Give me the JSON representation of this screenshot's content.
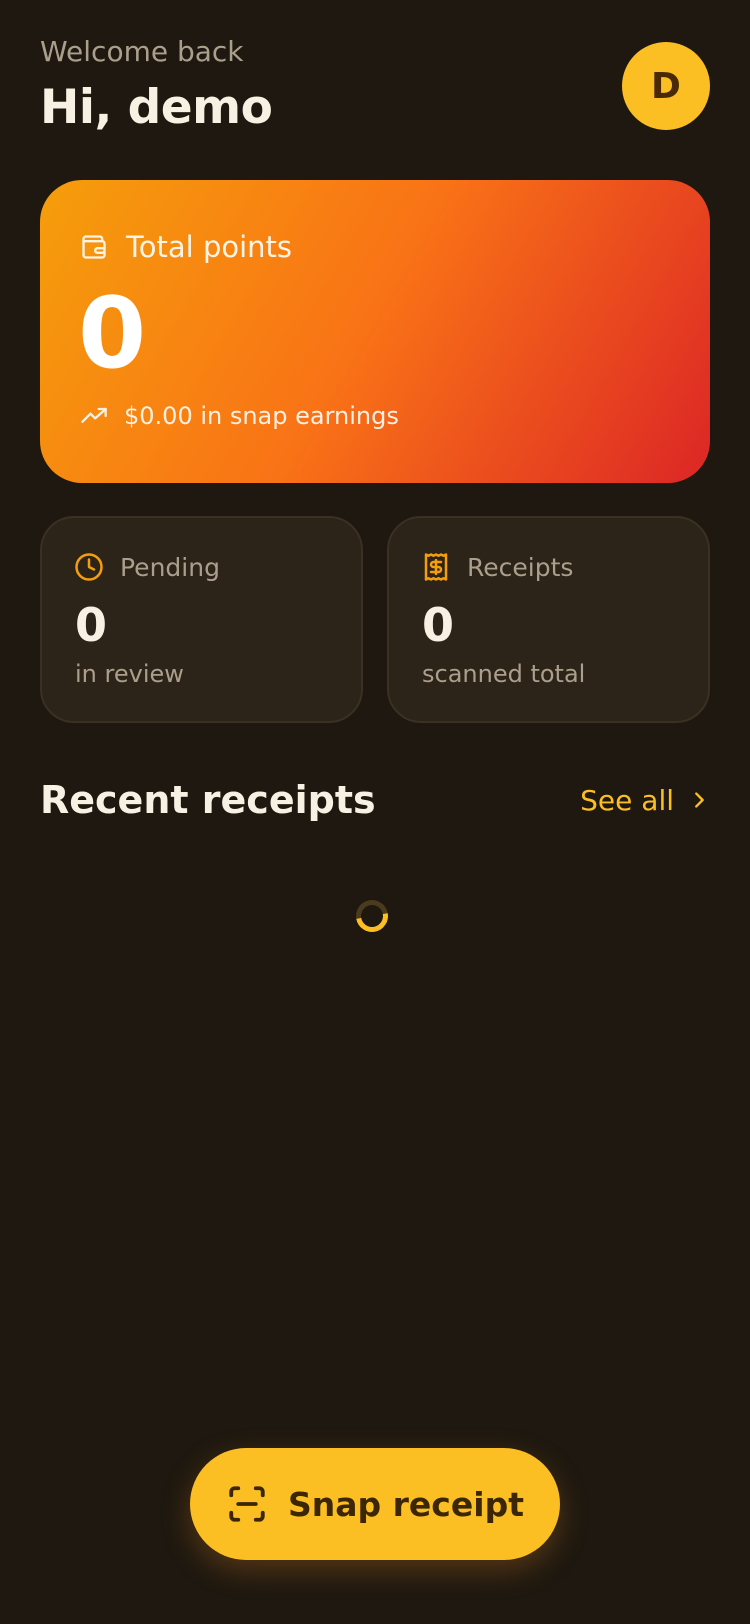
{
  "header": {
    "welcome": "Welcome back",
    "greeting": "Hi, demo",
    "avatar_initial": "D"
  },
  "points_card": {
    "label": "Total points",
    "value": "0",
    "earnings": "$0.00 in snap earnings",
    "label_icon": "wallet-icon",
    "earnings_icon": "trending-up-icon"
  },
  "stats": {
    "pending": {
      "label": "Pending",
      "value": "0",
      "sub": "in review",
      "icon": "clock-icon"
    },
    "receipts": {
      "label": "Receipts",
      "value": "0",
      "sub": "scanned total",
      "icon": "receipt-icon"
    }
  },
  "recent": {
    "title": "Recent receipts",
    "see_all": "See all"
  },
  "snap_button": {
    "label": "Snap receipt",
    "icon": "scan-icon"
  },
  "colors": {
    "background": "#1e1810",
    "accent": "#fbbf24",
    "card": "#2c2418",
    "gradient_start": "#f59e0b",
    "gradient_end": "#dc2626"
  }
}
